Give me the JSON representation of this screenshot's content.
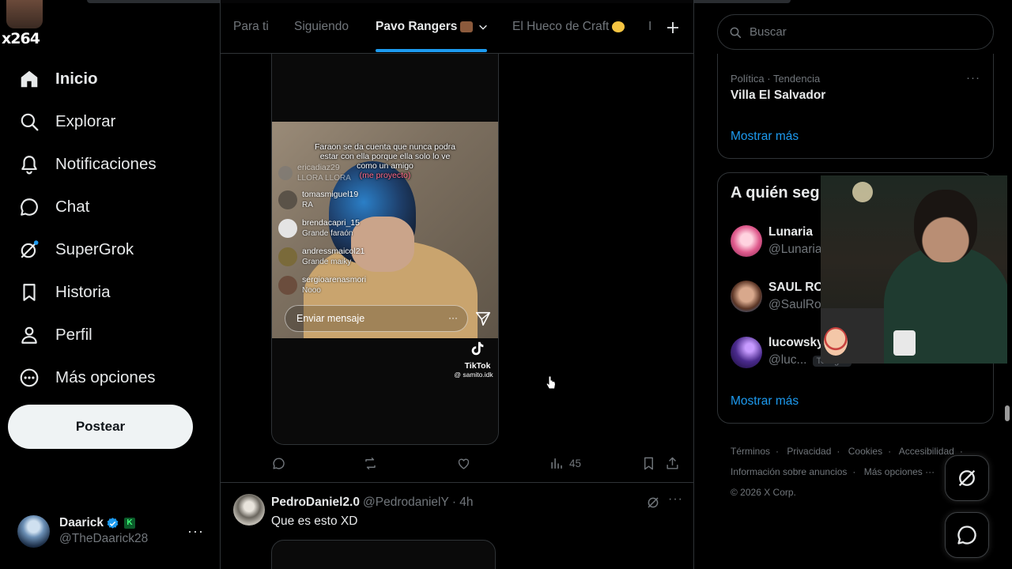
{
  "overlay": {
    "tag": "x264"
  },
  "nav": {
    "items": [
      {
        "label": "Inicio",
        "icon": "home-icon",
        "active": true
      },
      {
        "label": "Explorar",
        "icon": "search-icon"
      },
      {
        "label": "Notificaciones",
        "icon": "bell-icon"
      },
      {
        "label": "Chat",
        "icon": "chat-icon"
      },
      {
        "label": "SuperGrok",
        "icon": "grok-icon"
      },
      {
        "label": "Historia",
        "icon": "bookmark-icon"
      },
      {
        "label": "Perfil",
        "icon": "person-icon"
      },
      {
        "label": "Más opciones",
        "icon": "more-circle-icon"
      }
    ],
    "post_label": "Postear"
  },
  "account": {
    "name": "Daarick",
    "handle": "@TheDaarick28",
    "badge": "K",
    "more": "···"
  },
  "tabs": {
    "items": [
      "Para ti",
      "Siguiendo",
      "Pavo Rangers",
      "El Hueco de Craft",
      "I"
    ],
    "active_index": 2
  },
  "video": {
    "caption_line1": "Faraon se da cuenta que nunca podra",
    "caption_line2": "estar con ella porque ella solo lo ve",
    "caption_line3": "como un amigo",
    "caption_pink": "(me proyecto)",
    "faded_user": "ericadiaz29",
    "faded_text": "LLORA LLORA",
    "comments": [
      {
        "user": "tomasmiguel19",
        "text": "RA",
        "color": "#5a5248"
      },
      {
        "user": "brendacapri_15",
        "text": "Grande faraón",
        "color": "#e4e4e4"
      },
      {
        "user": "andressmaicol21",
        "text": "Grande maiky",
        "color": "#7a6a3a"
      },
      {
        "user": "sergioarenasmori",
        "text": "Nooo",
        "color": "#6b4d3d"
      }
    ],
    "message_placeholder": "Enviar mensaje",
    "message_more": "···",
    "tiktok_name": "TikTok",
    "tiktok_user": "@ samito.idk"
  },
  "post_actions": {
    "views": "45"
  },
  "post2": {
    "name": "PedroDaniel2.0",
    "handle": "@PedrodanielY",
    "time": "· 4h",
    "text": "Que es esto XD",
    "more": "···"
  },
  "search": {
    "placeholder": "Buscar"
  },
  "trend": {
    "meta": "Política · Tendencia",
    "name": "Villa El Salvador",
    "more": "···",
    "show_more": "Mostrar más"
  },
  "who_to_follow": {
    "title": "A quién seg",
    "users": [
      {
        "name": "Lunaria",
        "handle": "@Lunaria",
        "color": "#e05c8e",
        "follows": ""
      },
      {
        "name": "SAUL RO",
        "handle": "@SaulRo",
        "color": "#8a5a48",
        "follows": ""
      },
      {
        "name": "lucowskyx",
        "handle": "@luc...",
        "color": "#4a2a8c",
        "follows": "Te sigue"
      }
    ],
    "show_more": "Mostrar más"
  },
  "footer": {
    "links": [
      "Términos",
      "Privacidad",
      "Cookies",
      "Accesibilidad",
      "Información sobre anuncios",
      "Más opciones ···"
    ],
    "copyright": "© 2026 X Corp."
  },
  "colors": {
    "accent": "#1d9bf0",
    "text": "#e7e9ea",
    "muted": "#71767b",
    "border": "#2f3336"
  }
}
